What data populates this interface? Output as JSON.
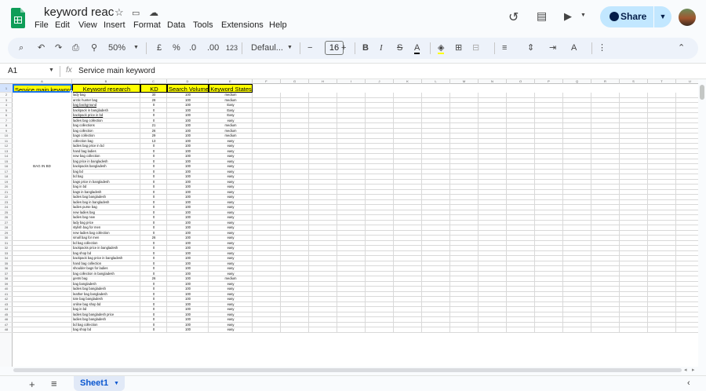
{
  "header": {
    "title": "keyword reac",
    "menu": [
      "File",
      "Edit",
      "View",
      "Insert",
      "Format",
      "Data",
      "Tools",
      "Extensions",
      "Help"
    ],
    "share_label": "Share"
  },
  "toolbar": {
    "zoom": "50%",
    "currency": "£",
    "percent": "%",
    "dec_less": ".0",
    "dec_more": ".00",
    "number_format": "123",
    "font": "Defaul...",
    "font_size": "16"
  },
  "formula_bar": {
    "cell_ref": "A1",
    "fx": "fx",
    "value": "Service main keyword"
  },
  "columns": [
    "A",
    "B",
    "C",
    "D",
    "E",
    "F",
    "G",
    "H",
    "I",
    "J",
    "K",
    "L",
    "M",
    "N",
    "O",
    "P",
    "Q",
    "R",
    "S",
    "T",
    "U"
  ],
  "table_headers": [
    "Service main keyword",
    "Keyword research",
    "KD",
    "Search Volume",
    "Keyword States"
  ],
  "merged_label": "BAG IN BD",
  "rows": [
    [
      "lady bag",
      "30",
      "100",
      "medium"
    ],
    [
      "arctic hunter bag",
      "28",
      "100",
      "medium"
    ],
    [
      "bag background",
      "0",
      "100",
      "Easy"
    ],
    [
      "backpack in bangladesh",
      "0",
      "100",
      "Easy"
    ],
    [
      "backpack price in bd",
      "0",
      "100",
      "Easy"
    ],
    [
      "ladies bag collection",
      "0",
      "100",
      "easy"
    ],
    [
      "bag collections",
      "21",
      "100",
      "medium"
    ],
    [
      "bag collection",
      "26",
      "100",
      "medium"
    ],
    [
      "bags collection",
      "29",
      "100",
      "medium"
    ],
    [
      "collection bag",
      "13",
      "100",
      "easy"
    ],
    [
      "ladies bag price in bd",
      "0",
      "100",
      "easy"
    ],
    [
      "hand bag ladies",
      "0",
      "100",
      "easy"
    ],
    [
      "new bag collection",
      "0",
      "100",
      "easy"
    ],
    [
      "bag price in bangladesh",
      "0",
      "100",
      "easy"
    ],
    [
      "backpacks bangladesh",
      "0",
      "100",
      "easy"
    ],
    [
      "bag bd",
      "0",
      "100",
      "easy"
    ],
    [
      "bd bag",
      "0",
      "100",
      "easy"
    ],
    [
      "bags price in bangladesh",
      "0",
      "100",
      "easy"
    ],
    [
      "bag in bd",
      "0",
      "100",
      "easy"
    ],
    [
      "bags in bangladesh",
      "0",
      "100",
      "easy"
    ],
    [
      "ladies bag bangladesh",
      "0",
      "100",
      "easy"
    ],
    [
      "ladies bag in bangladesh",
      "0",
      "100",
      "easy"
    ],
    [
      "ladies purse bag",
      "0",
      "100",
      "easy"
    ],
    [
      "new ladies bag",
      "0",
      "100",
      "easy"
    ],
    [
      "ladies bag new",
      "0",
      "100",
      "easy"
    ],
    [
      "lady bag price",
      "0",
      "100",
      "easy"
    ],
    [
      "stylish bag for men",
      "0",
      "100",
      "easy"
    ],
    [
      "new ladies bag collection",
      "0",
      "100",
      "easy"
    ],
    [
      "small bag for men",
      "26",
      "100",
      "easy"
    ],
    [
      "bd bag collection",
      "0",
      "100",
      "easy"
    ],
    [
      "backpacks price in bangladesh",
      "0",
      "100",
      "easy"
    ],
    [
      "bag shop bd",
      "0",
      "100",
      "easy"
    ],
    [
      "backpack bag price in bangladesh",
      "0",
      "100",
      "easy"
    ],
    [
      "hand bag collection",
      "0",
      "100",
      "easy"
    ],
    [
      "shoulder bags for ladies",
      "0",
      "100",
      "easy"
    ],
    [
      "bag collection in bangladesh",
      "0",
      "100",
      "easy"
    ],
    [
      "gents bag",
      "26",
      "100",
      "medium"
    ],
    [
      "bag bangladesh",
      "0",
      "100",
      "easy"
    ],
    [
      "ladies bag bangladesh",
      "0",
      "100",
      "easy"
    ],
    [
      "leather bag bangladesh",
      "0",
      "100",
      "easy"
    ],
    [
      "tote bag bangladesh",
      "0",
      "100",
      "easy"
    ],
    [
      "online bag shop bd",
      "0",
      "100",
      "easy"
    ],
    [
      "bag in bd",
      "0",
      "100",
      "easy"
    ],
    [
      "ladies bag bangladesh price",
      "0",
      "100",
      "easy"
    ],
    [
      "ladies bag bangladesh",
      "0",
      "100",
      "easy"
    ],
    [
      "bd bag collection",
      "0",
      "100",
      "easy"
    ],
    [
      "bag shop bd",
      "0",
      "100",
      "easy"
    ]
  ],
  "underlined_rows": [
    3,
    4,
    5
  ],
  "bottom": {
    "sheet_name": "Sheet1"
  },
  "colors": {
    "header_fill": "#ffff00",
    "accent": "#0b57d0",
    "share_bg": "#c2e7ff"
  }
}
